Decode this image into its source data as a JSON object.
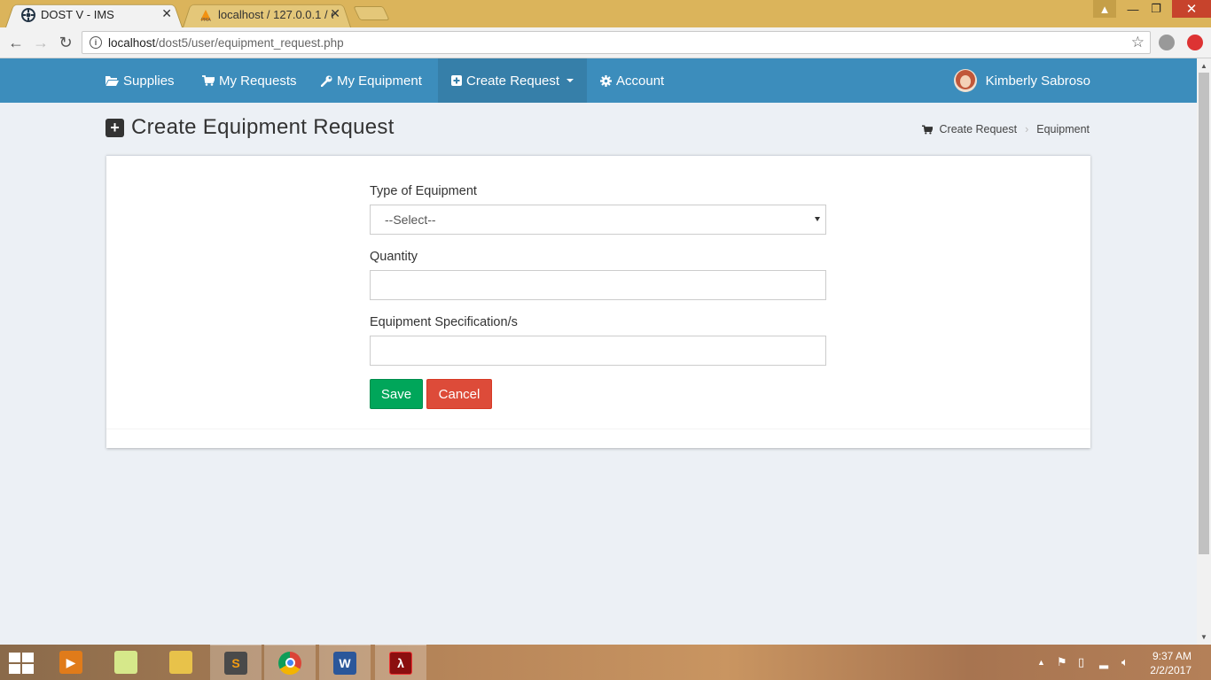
{
  "browser": {
    "tabs": [
      {
        "title": "DOST V - IMS",
        "active": true
      },
      {
        "title": "localhost / 127.0.0.1 / do",
        "active": false
      }
    ],
    "url_host": "localhost",
    "url_path": "/dost5/user/equipment_request.php"
  },
  "nav": {
    "items": [
      {
        "label": "Supplies",
        "icon": "folder-open-icon"
      },
      {
        "label": "My Requests",
        "icon": "cart-icon"
      },
      {
        "label": "My Equipment",
        "icon": "wrench-icon"
      },
      {
        "label": "Create Request",
        "icon": "plus-square-icon"
      },
      {
        "label": "Account",
        "icon": "gear-icon"
      }
    ],
    "user_name": "Kimberly Sabroso"
  },
  "page": {
    "title": "Create Equipment Request",
    "breadcrumb": [
      "Create Request",
      "Equipment"
    ]
  },
  "form": {
    "type_label": "Type of Equipment",
    "type_value": "--Select--",
    "quantity_label": "Quantity",
    "quantity_value": "",
    "spec_label": "Equipment Specification/s",
    "spec_value": "",
    "save_label": "Save",
    "cancel_label": "Cancel"
  },
  "taskbar": {
    "time": "9:37 AM",
    "date": "2/2/2017"
  },
  "colors": {
    "nav_bg": "#3c8dbc",
    "save": "#00a65a",
    "cancel": "#dd4b39"
  }
}
